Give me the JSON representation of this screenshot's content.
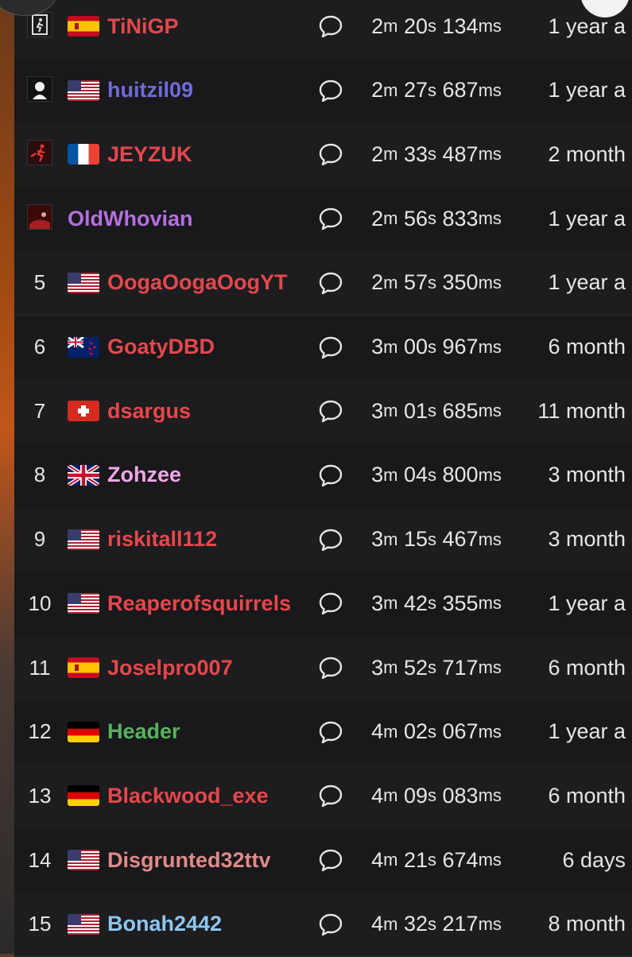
{
  "leaderboard": {
    "rows": [
      {
        "rank": "",
        "avatar": "runner-icon",
        "flag": "es",
        "name": "TiNiGP",
        "color": "#e5484d",
        "min": "2",
        "sec": "20",
        "ms": "134",
        "age": "1 year a"
      },
      {
        "rank": "",
        "avatar": "silhouette-icon",
        "flag": "us",
        "name": "huitzil09",
        "color": "#6f6bdb",
        "min": "2",
        "sec": "27",
        "ms": "687",
        "age": "1 year a"
      },
      {
        "rank": "",
        "avatar": "runner-red-icon",
        "flag": "fr",
        "name": "JEYZUK",
        "color": "#e5484d",
        "min": "2",
        "sec": "33",
        "ms": "487",
        "age": "2 month"
      },
      {
        "rank": "",
        "avatar": "red-scene-icon",
        "flag": "",
        "name": "OldWhovian",
        "color": "#b46fe0",
        "min": "2",
        "sec": "56",
        "ms": "833",
        "age": "1 year a"
      },
      {
        "rank": "5",
        "avatar": "",
        "flag": "us",
        "name": "OogaOogaOogYT",
        "color": "#e5484d",
        "min": "2",
        "sec": "57",
        "ms": "350",
        "age": "1 year a"
      },
      {
        "rank": "6",
        "avatar": "",
        "flag": "nz",
        "name": "GoatyDBD",
        "color": "#e5484d",
        "min": "3",
        "sec": "00",
        "ms": "967",
        "age": "6 month"
      },
      {
        "rank": "7",
        "avatar": "",
        "flag": "ch",
        "name": "dsargus",
        "color": "#e5484d",
        "min": "3",
        "sec": "01",
        "ms": "685",
        "age": "11 month"
      },
      {
        "rank": "8",
        "avatar": "",
        "flag": "gb",
        "name": "Zohzee",
        "color": "#f2a6e8",
        "min": "3",
        "sec": "04",
        "ms": "800",
        "age": "3 month"
      },
      {
        "rank": "9",
        "avatar": "",
        "flag": "us",
        "name": "riskitall112",
        "color": "#e5484d",
        "min": "3",
        "sec": "15",
        "ms": "467",
        "age": "3 month"
      },
      {
        "rank": "10",
        "avatar": "",
        "flag": "us",
        "name": "Reaperofsquirrels",
        "color": "#e5484d",
        "min": "3",
        "sec": "42",
        "ms": "355",
        "age": "1 year a"
      },
      {
        "rank": "11",
        "avatar": "",
        "flag": "es",
        "name": "Joselpro007",
        "color": "#e5484d",
        "min": "3",
        "sec": "52",
        "ms": "717",
        "age": "6 month"
      },
      {
        "rank": "12",
        "avatar": "",
        "flag": "de",
        "name": "Header",
        "color": "#56b35f",
        "min": "4",
        "sec": "02",
        "ms": "067",
        "age": "1 year a"
      },
      {
        "rank": "13",
        "avatar": "",
        "flag": "de",
        "name": "Blackwood_exe",
        "color": "#e5484d",
        "min": "4",
        "sec": "09",
        "ms": "083",
        "age": "6 month"
      },
      {
        "rank": "14",
        "avatar": "",
        "flag": "us",
        "name": "Disgrunted32ttv",
        "color": "#e08a8a",
        "min": "4",
        "sec": "21",
        "ms": "674",
        "age": "6 days"
      },
      {
        "rank": "15",
        "avatar": "",
        "flag": "us",
        "name": "Bonah2442",
        "color": "#8fc6f0",
        "min": "4",
        "sec": "32",
        "ms": "217",
        "age": "8 month"
      }
    ]
  }
}
